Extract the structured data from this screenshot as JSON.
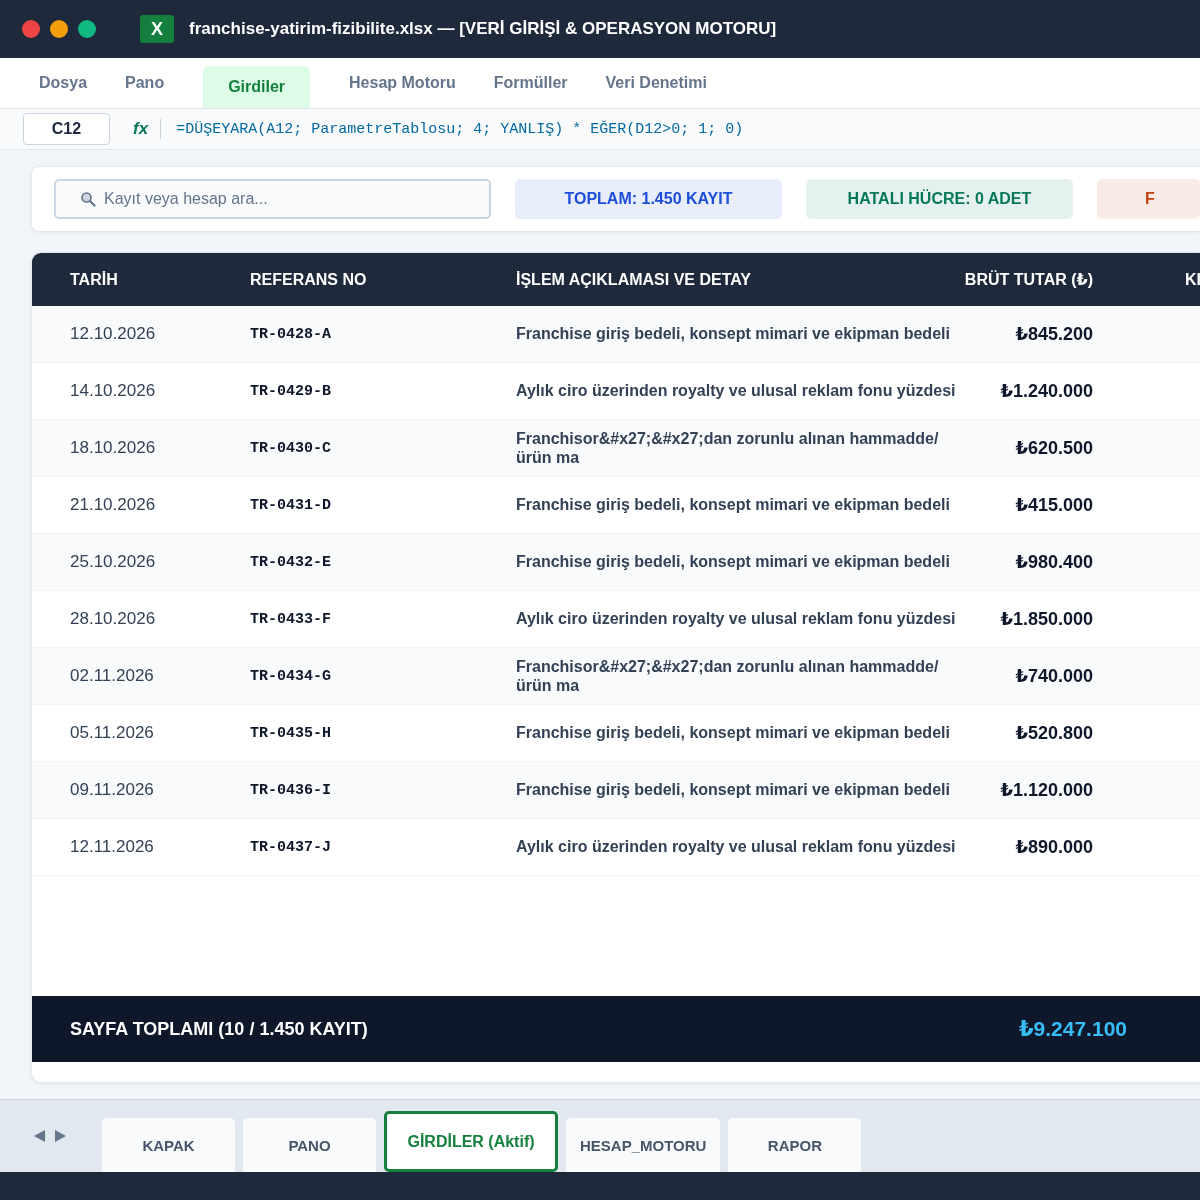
{
  "window": {
    "title": "franchise-yatirim-fizibilite.xlsx — [VERİ GİRİŞİ & OPERASYON MOTORU]",
    "app_icon": "X"
  },
  "menu": [
    {
      "label": "Dosya",
      "selected": false
    },
    {
      "label": "Pano",
      "selected": false
    },
    {
      "label": "Girdiler",
      "selected": true
    },
    {
      "label": "Hesap Motoru",
      "selected": false
    },
    {
      "label": "Formüller",
      "selected": false
    },
    {
      "label": "Veri Denetimi",
      "selected": false
    }
  ],
  "formula_bar": {
    "cell": "C12",
    "fx": "fx",
    "formula": "=DÜŞEYARA(A12; ParametreTablosu; 4; YANLIŞ) * EĞER(D12>0; 1; 0)"
  },
  "search": {
    "placeholder": "Kayıt veya hesap ara..."
  },
  "badges": [
    {
      "text": "TOPLAM: 1.450 KAYIT",
      "color": "#1d4ed8"
    },
    {
      "text": "HATALI HÜCRE: 0 ADET",
      "color": "#047857"
    },
    {
      "text": "F",
      "color": "#c2410c"
    }
  ],
  "table": {
    "columns": [
      "TARİH",
      "REFERANS NO",
      "İŞLEM AÇIKLAMASI VE DETAY",
      "BRÜT TUTAR (₺)",
      "KI"
    ],
    "rows": [
      {
        "date": "12.10.2026",
        "ref": "TR-0428-A",
        "desc": "Franchise giriş bedeli, konsept mimari ve ekipman bedeli",
        "amount": "₺845.200"
      },
      {
        "date": "14.10.2026",
        "ref": "TR-0429-B",
        "desc": "Aylık ciro üzerinden royalty ve ulusal reklam fonu yüzdesi",
        "amount": "₺1.240.000"
      },
      {
        "date": "18.10.2026",
        "ref": "TR-0430-C",
        "desc": "Franchisor&#x27;&#x27;dan zorunlu alınan hammadde/ürün ma",
        "amount": "₺620.500"
      },
      {
        "date": "21.10.2026",
        "ref": "TR-0431-D",
        "desc": "Franchise giriş bedeli, konsept mimari ve ekipman bedeli",
        "amount": "₺415.000"
      },
      {
        "date": "25.10.2026",
        "ref": "TR-0432-E",
        "desc": "Franchise giriş bedeli, konsept mimari ve ekipman bedeli",
        "amount": "₺980.400"
      },
      {
        "date": "28.10.2026",
        "ref": "TR-0433-F",
        "desc": "Aylık ciro üzerinden royalty ve ulusal reklam fonu yüzdesi",
        "amount": "₺1.850.000"
      },
      {
        "date": "02.11.2026",
        "ref": "TR-0434-G",
        "desc": "Franchisor&#x27;&#x27;dan zorunlu alınan hammadde/ürün ma",
        "amount": "₺740.000"
      },
      {
        "date": "05.11.2026",
        "ref": "TR-0435-H",
        "desc": "Franchise giriş bedeli, konsept mimari ve ekipman bedeli",
        "amount": "₺520.800"
      },
      {
        "date": "09.11.2026",
        "ref": "TR-0436-I",
        "desc": "Franchise giriş bedeli, konsept mimari ve ekipman bedeli",
        "amount": "₺1.120.000"
      },
      {
        "date": "12.11.2026",
        "ref": "TR-0437-J",
        "desc": "Aylık ciro üzerinden royalty ve ulusal reklam fonu yüzdesi",
        "amount": "₺890.000"
      }
    ],
    "footer": {
      "label": "SAYFA TOPLAMI (10 / 1.450 KAYIT)",
      "total": "₺9.247.100"
    }
  },
  "sheet_tabs": [
    {
      "label": "KAPAK",
      "selected": false
    },
    {
      "label": "PANO",
      "selected": false
    },
    {
      "label": "GİRDİLER (Aktif)",
      "selected": true
    },
    {
      "label": "HESAP_MOTORU",
      "selected": false
    },
    {
      "label": "RAPOR",
      "selected": false
    }
  ]
}
